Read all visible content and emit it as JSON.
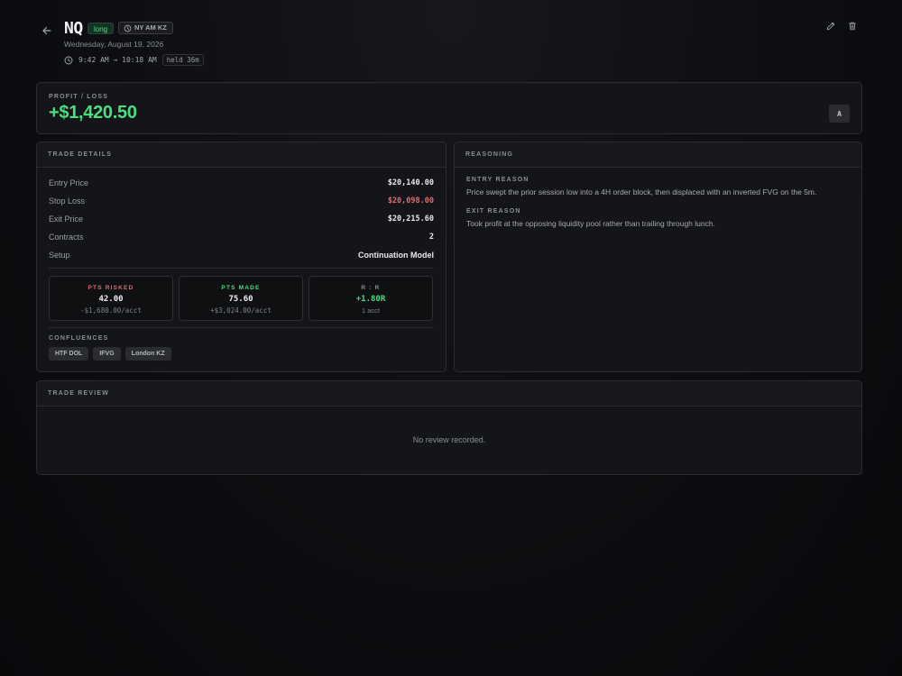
{
  "header": {
    "symbol": "NQ",
    "side": "long",
    "session": "NY AM KZ",
    "date": "Wednesday, August 19, 2026",
    "time_range": "9:42 AM → 10:18 AM",
    "held": "held 36m"
  },
  "profit_loss": {
    "label": "PROFIT / LOSS",
    "value": "+$1,420.50",
    "grade": "A"
  },
  "trade_details": {
    "title": "TRADE DETAILS",
    "rows": [
      {
        "label": "Entry Price",
        "value": "$20,140.00"
      },
      {
        "label": "Stop Loss",
        "value": "$20,098.00"
      },
      {
        "label": "Exit Price",
        "value": "$20,215.60"
      },
      {
        "label": "Contracts",
        "value": "2"
      },
      {
        "label": "Setup",
        "value": "Continuation Model"
      }
    ],
    "stats": [
      {
        "label": "PTS RISKED",
        "value": "42.00",
        "sub": "-$1,680.00/acct"
      },
      {
        "label": "PTS MADE",
        "value": "75.60",
        "sub": "+$3,024.00/acct"
      },
      {
        "label": "R : R",
        "value": "+1.80R",
        "sub": "1 acct"
      }
    ],
    "confluences_label": "CONFLUENCES",
    "confluences": [
      "HTF DOL",
      "IFVG",
      "London KZ"
    ]
  },
  "reasoning": {
    "title": "REASONING",
    "entry_label": "ENTRY REASON",
    "entry_text": "Price swept the prior session low into a 4H order block, then displaced with an inverted FVG on the 5m.",
    "exit_label": "EXIT REASON",
    "exit_text": "Took profit at the opposing liquidity pool rather than trailing through lunch."
  },
  "review": {
    "title": "TRADE REVIEW",
    "empty_text": "No review recorded."
  },
  "colors": {
    "profit": "#4ade80",
    "loss": "#e06b73",
    "background": "#0b0c0f",
    "card": "#141518"
  },
  "icons": [
    "arrow-left-icon",
    "clock-icon",
    "pencil-icon",
    "trash-icon"
  ]
}
